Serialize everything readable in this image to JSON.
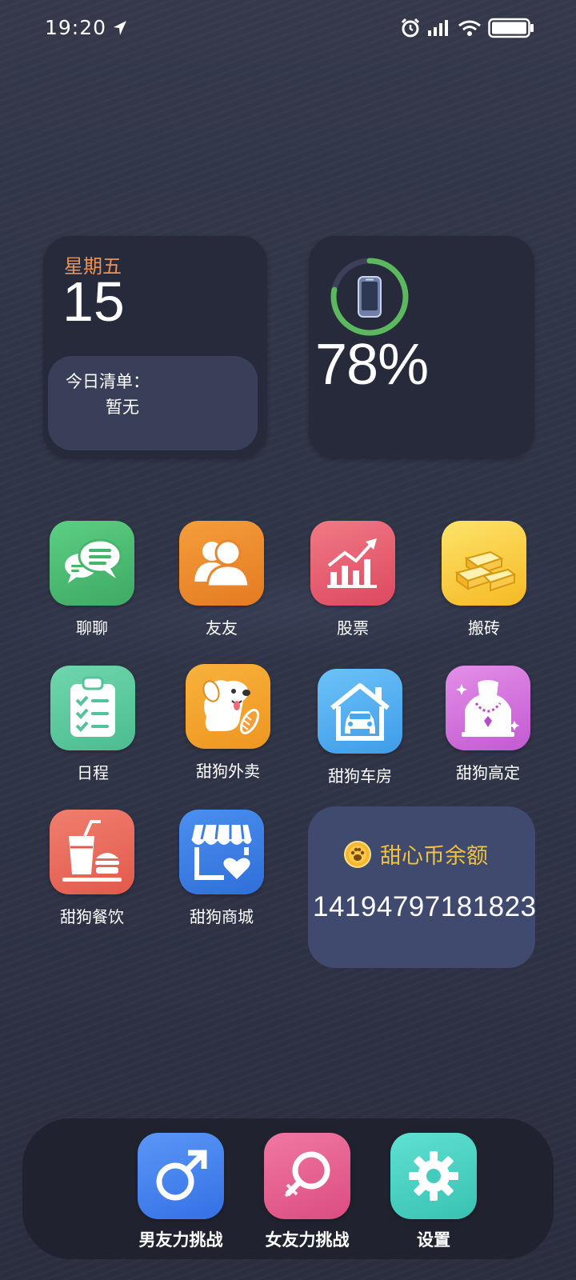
{
  "status_bar": {
    "time": "19:20",
    "icons": [
      "location-arrow-icon",
      "alarm-icon",
      "signal-icon",
      "wifi-icon",
      "battery-icon"
    ]
  },
  "date_widget": {
    "weekday": "星期五",
    "day": "15",
    "todo_title": "今日清单：",
    "todo_value": "暂无"
  },
  "battery_widget": {
    "percent_text": "78%",
    "level": 0.78,
    "ring_color": "#5cb85c",
    "icon": "phone-icon"
  },
  "apps": [
    {
      "label": "聊聊",
      "icon": "chat-bubbles-icon",
      "color": "#4db870"
    },
    {
      "label": "友友",
      "icon": "friends-icon",
      "color": "#ee8a2c"
    },
    {
      "label": "股票",
      "icon": "stock-chart-icon",
      "color": "#e4566b"
    },
    {
      "label": "搬砖",
      "icon": "gold-bars-icon",
      "color": "#f6c53a"
    },
    {
      "label": "日程",
      "icon": "clipboard-checklist-icon",
      "color": "#5fcaa0"
    },
    {
      "label": "甜狗外卖",
      "icon": "dog-food-delivery-icon",
      "color": "#f4a22e"
    },
    {
      "label": "甜狗车房",
      "icon": "house-car-icon",
      "color": "#4ea8ec"
    },
    {
      "label": "甜狗高定",
      "icon": "necklace-bust-icon",
      "color": "#cc6ad8"
    },
    {
      "label": "甜狗餐饮",
      "icon": "drink-burger-icon",
      "color": "#ec6a5a"
    },
    {
      "label": "甜狗商城",
      "icon": "store-heart-icon",
      "color": "#3f84e5"
    }
  ],
  "coin_widget": {
    "title": "甜心币余额",
    "value": "14194797181823",
    "icon": "paw-coin-icon"
  },
  "dock": [
    {
      "label": "男友力挑战",
      "icon": "male-symbol-icon",
      "color": "#3f7ff0"
    },
    {
      "label": "女友力挑战",
      "icon": "female-symbol-icon",
      "color": "#e85b8d"
    },
    {
      "label": "设置",
      "icon": "gear-icon",
      "color": "#49d3c3"
    }
  ]
}
